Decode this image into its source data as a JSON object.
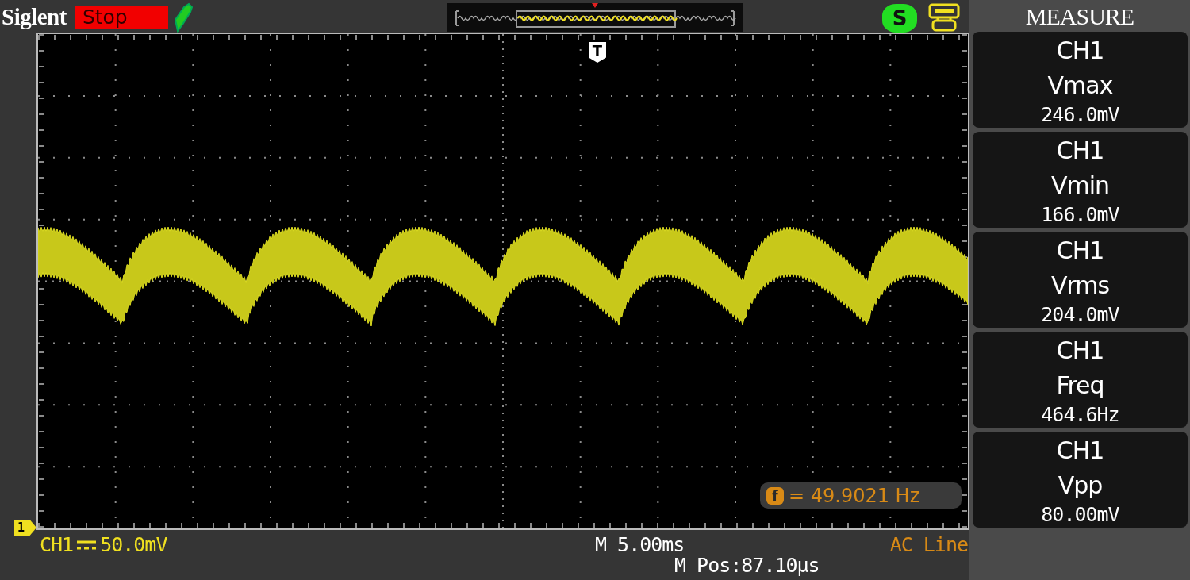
{
  "header": {
    "brand": "Siglent",
    "run_state": "Stop",
    "status_icon_letter": "S"
  },
  "plot": {
    "trigger_marker": "T",
    "channel_marker": "1",
    "counter_symbol": "f",
    "counter_reading": "= 49.9021 Hz"
  },
  "measure": {
    "title": "MEASURE",
    "items": [
      {
        "channel": "CH1",
        "name": "Vmax",
        "value": "246.0mV"
      },
      {
        "channel": "CH1",
        "name": "Vmin",
        "value": "166.0mV"
      },
      {
        "channel": "CH1",
        "name": "Vrms",
        "value": "204.0mV"
      },
      {
        "channel": "CH1",
        "name": "Freq",
        "value": "464.6Hz"
      },
      {
        "channel": "CH1",
        "name": "Vpp",
        "value": "80.00mV"
      }
    ]
  },
  "status_bar": {
    "channel": "CH1",
    "volts_per_div": "50.0mV",
    "time_per_div": "M 5.00ms",
    "trigger_source": "AC Line",
    "position": "M Pos:87.10µs"
  }
}
